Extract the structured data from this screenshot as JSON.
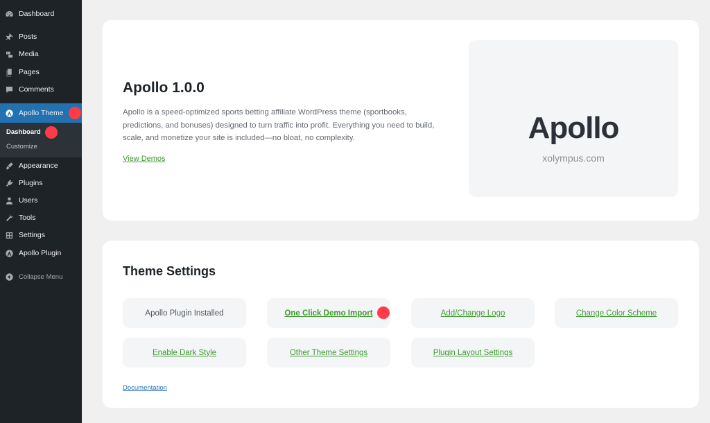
{
  "sidebar": {
    "items": [
      {
        "label": "Dashboard",
        "icon": "dashboard-icon"
      },
      {
        "label": "Posts",
        "icon": "pin-icon"
      },
      {
        "label": "Media",
        "icon": "media-icon"
      },
      {
        "label": "Pages",
        "icon": "pages-icon"
      },
      {
        "label": "Comments",
        "icon": "comment-icon"
      },
      {
        "label": "Apollo Theme",
        "icon": "apollo-icon"
      },
      {
        "label": "Appearance",
        "icon": "brush-icon"
      },
      {
        "label": "Plugins",
        "icon": "plug-icon"
      },
      {
        "label": "Users",
        "icon": "user-icon"
      },
      {
        "label": "Tools",
        "icon": "wrench-icon"
      },
      {
        "label": "Settings",
        "icon": "settings-icon"
      },
      {
        "label": "Apollo Plugin",
        "icon": "apollo-icon"
      }
    ],
    "submenu": [
      {
        "label": "Dashboard"
      },
      {
        "label": "Customize"
      }
    ],
    "collapse_label": "Collapse Menu",
    "accent_color": "#2271b1",
    "marker_color": "#ff3b47"
  },
  "hero": {
    "title": "Apollo 1.0.0",
    "description": "Apollo is a speed-optimized sports betting affiliate WordPress theme (sportbooks, predictions, and bonuses) designed to turn traffic into profit. Everything you need to build, scale, and monetize your site is included—no bloat, no complexity.",
    "link_label": "View Demos",
    "logo_text": "Apollo",
    "logo_domain": "xolympus.com"
  },
  "settings": {
    "title": "Theme Settings",
    "buttons": [
      {
        "label": "Apollo Plugin Installed"
      },
      {
        "label": "One Click Demo Import"
      },
      {
        "label": "Add/Change Logo"
      },
      {
        "label": "Change Color Scheme"
      },
      {
        "label": "Enable Dark Style"
      },
      {
        "label": "Other Theme Settings"
      },
      {
        "label": "Plugin Layout Settings"
      }
    ],
    "documentation_label": "Documentation",
    "link_color": "#3d9a2e"
  }
}
